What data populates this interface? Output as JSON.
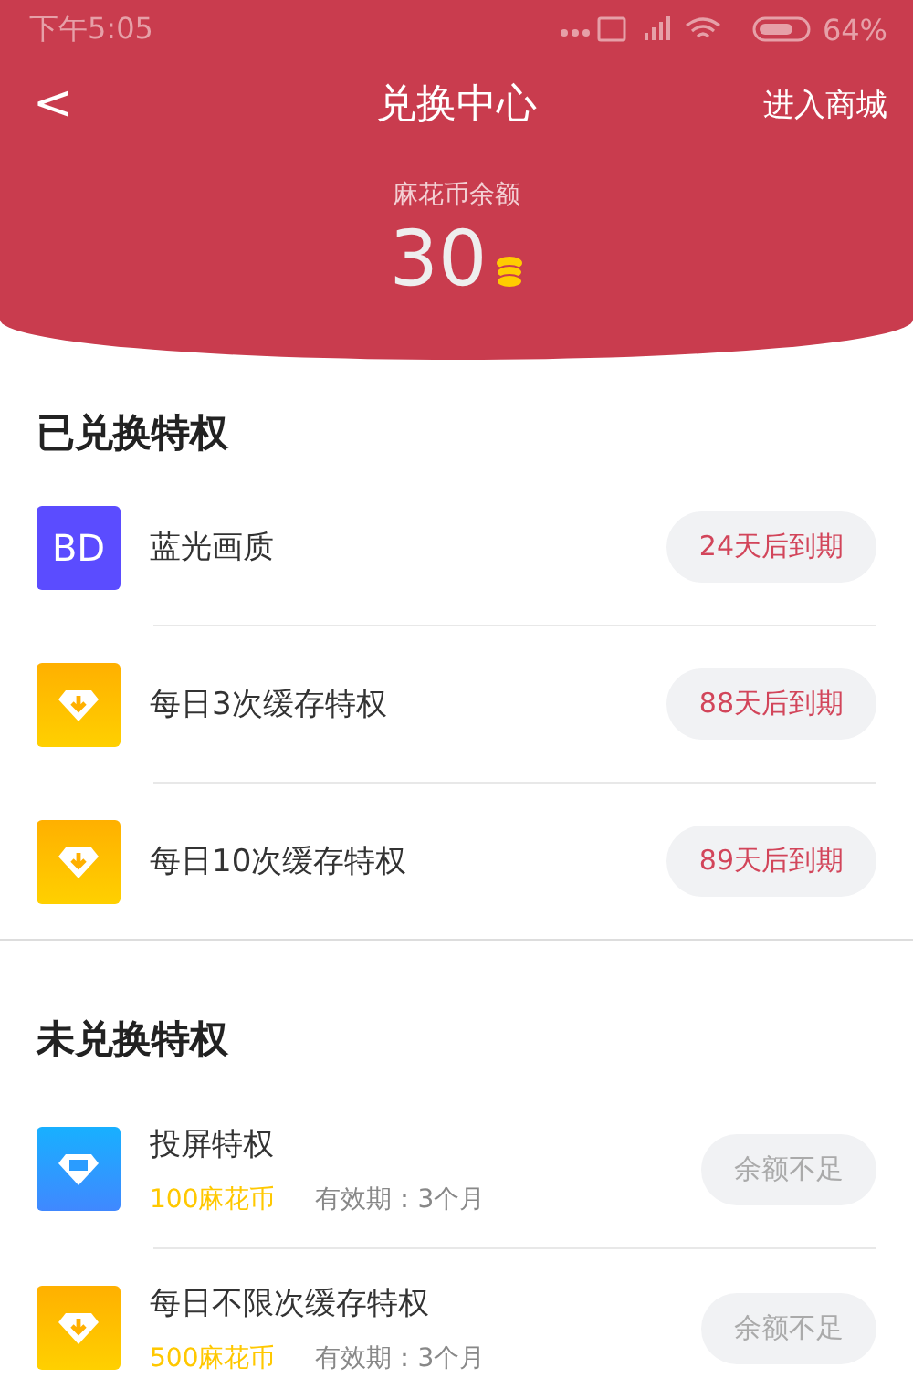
{
  "status_bar": {
    "time": "下午5:05",
    "battery": "64%"
  },
  "header": {
    "back": "<",
    "title": "兑换中心",
    "action": "进入商城",
    "balance_label": "麻花币余额",
    "balance": "30"
  },
  "redeemed": {
    "title": "已兑换特权",
    "items": [
      {
        "kind": "bd",
        "icon_text": "BD",
        "name": "蓝光画质",
        "status": "24天后到期"
      },
      {
        "kind": "download",
        "name": "每日3次缓存特权",
        "status": "88天后到期"
      },
      {
        "kind": "download",
        "name": "每日10次缓存特权",
        "status": "89天后到期"
      }
    ]
  },
  "available": {
    "title": "未兑换特权",
    "items": [
      {
        "kind": "screen",
        "name": "投屏特权",
        "price": "100麻花币",
        "validity": "有效期：3个月",
        "button": "余额不足",
        "disabled": true
      },
      {
        "kind": "download",
        "name": "每日不限次缓存特权",
        "price": "500麻花币",
        "validity": "有效期：3个月",
        "button": "余额不足",
        "disabled": true
      }
    ]
  }
}
